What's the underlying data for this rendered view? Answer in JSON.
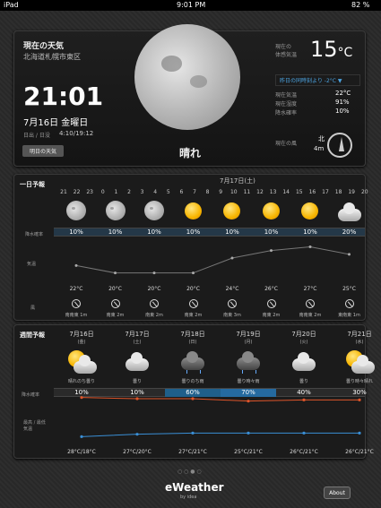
{
  "status": {
    "device": "iPad",
    "time": "9:01 PM",
    "battery": "82 %"
  },
  "current": {
    "title": "現在の天気",
    "location": "北海道札幌市東区",
    "time": "21:01",
    "date": "7月16日 金曜日",
    "sunlabel": "日出 / 日没",
    "sun": "4:10/19:12",
    "forecast_button": "明日の天気",
    "condition": "晴れ",
    "feels_label_1": "現在の",
    "feels_label_2": "体感気温",
    "feels_temp": "15",
    "unit": "°C",
    "diff_text": "昨日の同時刻より -2°C ▼",
    "metrics": [
      {
        "label": "現在気温",
        "value": "22°C"
      },
      {
        "label": "現在湿度",
        "value": "91%"
      },
      {
        "label": "降水確率",
        "value": "10%"
      }
    ],
    "wind_label": "現在の風",
    "wind_dir": "北",
    "wind_speed": "4m"
  },
  "daily": {
    "title": "一日予報",
    "date": "7月17日(土)",
    "hours": [
      "21",
      "22",
      "23",
      "0",
      "1",
      "2",
      "3",
      "4",
      "5",
      "6",
      "7",
      "8",
      "9",
      "10",
      "11",
      "12",
      "13",
      "14",
      "15",
      "16",
      "17",
      "18",
      "19",
      "20"
    ],
    "row_labels": [
      "降水確率",
      "気温",
      "風"
    ],
    "slots": [
      {
        "icon": "moon-icon",
        "rain": "10%",
        "temp": "22°C",
        "wind": "南南東 1m"
      },
      {
        "icon": "moon-icon",
        "rain": "10%",
        "temp": "20°C",
        "wind": "南東 2m"
      },
      {
        "icon": "moon-icon",
        "rain": "10%",
        "temp": "20°C",
        "wind": "南東 2m"
      },
      {
        "icon": "sun-icon",
        "rain": "10%",
        "temp": "20°C",
        "wind": "南東 2m"
      },
      {
        "icon": "sun-icon",
        "rain": "10%",
        "temp": "24°C",
        "wind": "南東 3m"
      },
      {
        "icon": "sun-icon",
        "rain": "10%",
        "temp": "26°C",
        "wind": "南東 2m"
      },
      {
        "icon": "sun-icon",
        "rain": "10%",
        "temp": "27°C",
        "wind": "南南東 2m"
      },
      {
        "icon": "cloud-icon",
        "rain": "20%",
        "temp": "25°C",
        "wind": "東南東 1m"
      }
    ],
    "temps": [
      22,
      20,
      20,
      20,
      24,
      26,
      27,
      25
    ]
  },
  "weekly": {
    "title": "週間予報",
    "row_labels": [
      "降水確率",
      "最高 / 最低 気温"
    ],
    "days": [
      {
        "date": "7月16日",
        "dow": "(金)",
        "icon": "sun-cloud-icon",
        "cond": "晴れのち曇り",
        "rain": "10%",
        "temps": "28°C/18°C",
        "hi": 28,
        "lo": 18
      },
      {
        "date": "7月17日",
        "dow": "(土)",
        "icon": "cloud-icon",
        "cond": "曇り",
        "rain": "10%",
        "temps": "27°C/20°C",
        "hi": 27,
        "lo": 20
      },
      {
        "date": "7月18日",
        "dow": "(日)",
        "icon": "rain-cloud-icon",
        "cond": "曇りのち雨",
        "rain": "60%",
        "temps": "27°C/21°C",
        "hi": 27,
        "lo": 21
      },
      {
        "date": "7月19日",
        "dow": "(月)",
        "icon": "rain-cloud-icon",
        "cond": "曇り時々雨",
        "rain": "70%",
        "temps": "25°C/21°C",
        "hi": 25,
        "lo": 21
      },
      {
        "date": "7月20日",
        "dow": "(火)",
        "icon": "cloud-icon",
        "cond": "曇り",
        "rain": "40%",
        "temps": "26°C/21°C",
        "hi": 26,
        "lo": 21
      },
      {
        "date": "7月21日",
        "dow": "(水)",
        "icon": "sun-cloud-icon",
        "cond": "曇り時々晴れ",
        "rain": "30%",
        "temps": "26°C/21°C",
        "hi": 26,
        "lo": 21
      }
    ]
  },
  "footer": {
    "app": "eWeather",
    "by": "by idea",
    "about": "About"
  },
  "colors": {
    "hi": "#e0552a",
    "lo": "#3a8fd6",
    "accent_bar": "#1f5f8a",
    "rain_hi": "#256aa0"
  }
}
